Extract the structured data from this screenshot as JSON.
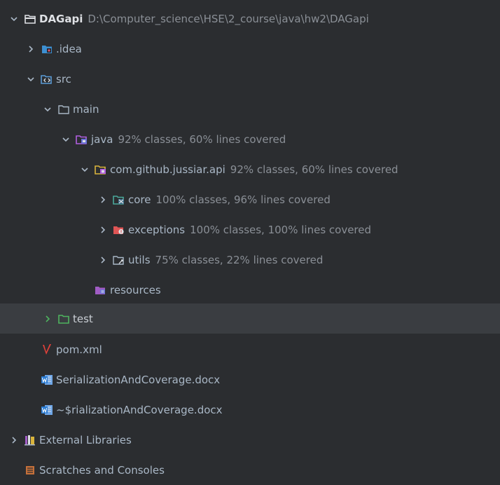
{
  "tree": {
    "root": {
      "name": "DAGapi",
      "path": "D:\\Computer_science\\HSE\\2_course\\java\\hw2\\DAGapi"
    },
    "idea": {
      "name": ".idea"
    },
    "src": {
      "name": "src"
    },
    "main": {
      "name": "main"
    },
    "java": {
      "name": "java",
      "coverage": "92% classes, 60% lines covered"
    },
    "package": {
      "name": "com.github.jussiar.api",
      "coverage": "92% classes, 60% lines covered"
    },
    "core": {
      "name": "core",
      "coverage": "100% classes, 96% lines covered"
    },
    "exceptions": {
      "name": "exceptions",
      "coverage": "100% classes, 100% lines covered"
    },
    "utils": {
      "name": "utils",
      "coverage": "75% classes, 22% lines covered"
    },
    "resources": {
      "name": "resources"
    },
    "test": {
      "name": "test"
    },
    "pom": {
      "name": "pom.xml"
    },
    "doc1": {
      "name": "SerializationAndCoverage.docx"
    },
    "doc2": {
      "name": "~$rializationAndCoverage.docx"
    },
    "extlibs": {
      "name": "External Libraries"
    },
    "scratches": {
      "name": "Scratches and Consoles"
    }
  },
  "icons": {
    "folder": "folder-icon",
    "module": "module-folder-icon",
    "idea": "idea-folder-icon",
    "source": "source-root-icon",
    "package": "package-icon",
    "resources": "resources-root-icon",
    "test": "test-root-icon",
    "maven": "maven-icon",
    "word": "word-document-icon",
    "libraries": "libraries-icon",
    "scratches": "scratches-icon"
  },
  "colors": {
    "background": "#2b2d30",
    "selection": "#3a3d41",
    "text": "#a9b7c6",
    "coverage_text": "#8a8f96",
    "test_green": "#4eb35f",
    "source_blue": "#5b9bd5",
    "package_yellow": "#d9b43c",
    "exceptions_red": "#e05555",
    "resources_purple": "#a05cc4",
    "maven_red": "#e0413a",
    "word_blue": "#2b7cd3"
  }
}
